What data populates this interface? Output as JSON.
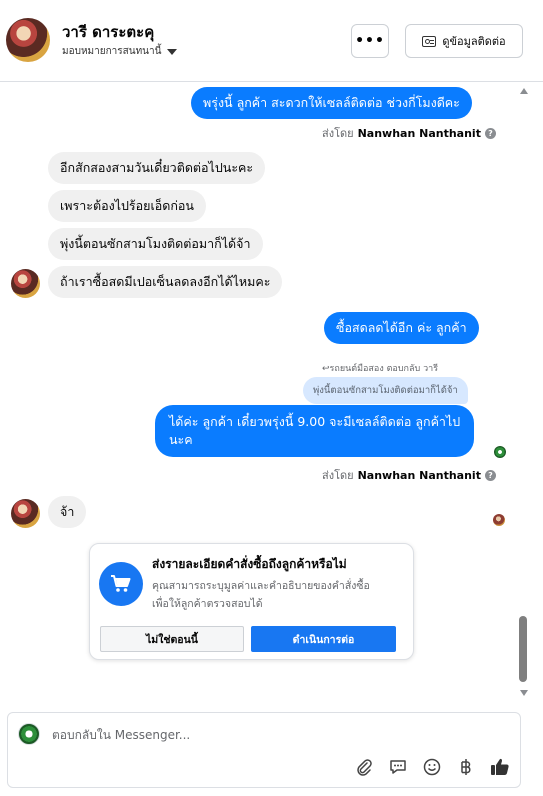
{
  "header": {
    "contact_name": "วารี ดาระตะคุ",
    "assign_label": "มอบหมายการสนทนานี้",
    "more_label": "•••",
    "contact_info_label": "ดูข้อมูลติดต่อ"
  },
  "messages": [
    {
      "direction": "out",
      "text": "พรุ่งนี้ ลูกค้า สะดวกให้เซลล์ติดต่อ ช่วงกี่โมงดีคะ"
    },
    {
      "type": "sent_by",
      "prefix": "ส่งโดย",
      "name": "Nanwhan Nanthanit"
    },
    {
      "direction": "in",
      "text": "อีกสักสองสามวันเดี๋ยวติดต่อไปนะคะ"
    },
    {
      "direction": "in",
      "text": "เพราะต้องไปร้อยเอ็ดก่อน"
    },
    {
      "direction": "in",
      "text": "พุ่งนี้ตอนซักสามโมงติดต่อมาก็ได้จ้า"
    },
    {
      "direction": "in",
      "text": "ถ้าเราซื้อสดมีเปอเซ็นลดลงอีกได้ไหมคะ"
    },
    {
      "direction": "out",
      "text": "ซื้อสดลดได้อีก ค่ะ ลูกค้า"
    },
    {
      "type": "reply_note",
      "text": "↩รถยนต์มือสอง ตอบกลับ วารี"
    },
    {
      "type": "quote",
      "text": "พุ่งนี้ตอนซักสามโมงติดต่อมาก็ได้จ้า"
    },
    {
      "direction": "out",
      "line1": "ได้ค่ะ ลูกค้า เดี๋ยวพรุ่งนี้ 9.00 จะมีเซลล์ติดต่อ ลูกค้าไป",
      "line2": "นะค"
    },
    {
      "type": "sent_by",
      "prefix": "ส่งโดย",
      "name": "Nanwhan Nanthanit"
    },
    {
      "direction": "in",
      "text": "จ้า"
    }
  ],
  "order_card": {
    "title": "ส่งรายละเอียดคำสั่งซื้อถึงลูกค้าหรือไม่",
    "desc_line1": "คุณสามารถระบุมูลค่าและคำอธิบายของคำสั่งซื้อ",
    "desc_line2": "เพื่อให้ลูกค้าตรวจสอบได้",
    "no_label": "ไม่ใช่ตอนนี้",
    "continue_label": "ดำเนินการต่อ",
    "icon": "shopping-cart-icon",
    "accent": "#1877f2"
  },
  "composer": {
    "placeholder": "ตอบกลับใน Messenger...",
    "tools": [
      "attachment-icon",
      "saved-reply-icon",
      "emoji-icon",
      "baht-icon",
      "thumbs-up-icon"
    ]
  },
  "colors": {
    "outgoing_bubble": "#0a7cff",
    "incoming_bubble": "#f0f0f0",
    "quote_bubble": "#d7e8ff"
  }
}
